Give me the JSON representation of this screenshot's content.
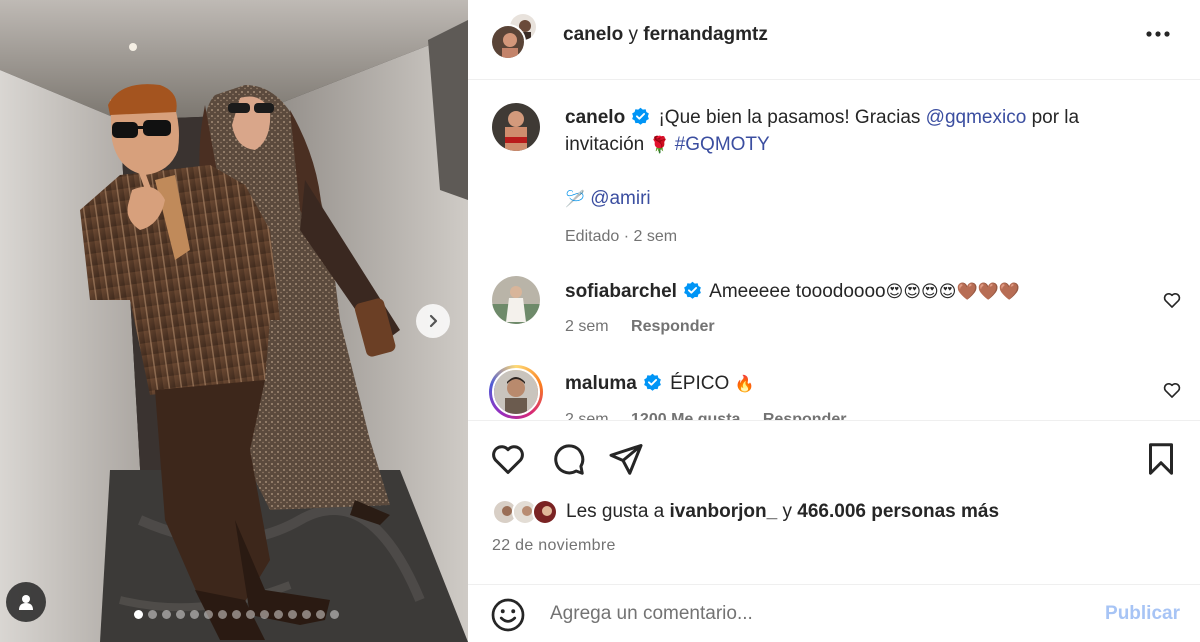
{
  "header": {
    "user1": "canelo",
    "connector": "y",
    "user2": "fernandagmtz"
  },
  "caption": {
    "username": "canelo",
    "text": "¡Que bien la pasamos! Gracias",
    "mention": "@gqmexico",
    "text2": "por la invitación",
    "emoji": "🌹",
    "hashtag": "#GQMOTY",
    "tag_icon": "🪡",
    "tag_mention": "@amiri",
    "edited": "Editado",
    "time": "2 sem"
  },
  "comments": [
    {
      "username": "sofiabarchel",
      "text": "Ameeeee tooodoooo",
      "emojis": "😍😍😍😍🤎🤎🤎",
      "time": "2 sem",
      "reply_label": "Responder"
    },
    {
      "username": "maluma",
      "text": "ÉPICO",
      "emojis": "🔥",
      "time": "2 sem",
      "likes_count": "1200 Me gusta",
      "reply_label": "Responder"
    }
  ],
  "likes": {
    "prefix": "Les gusta a",
    "user": "ivanborjon_",
    "connector": "y",
    "count": "466.006 personas más"
  },
  "date": "22 de noviembre",
  "composer": {
    "placeholder": "Agrega un comentario...",
    "publish": "Publicar"
  },
  "carousel": {
    "total": 15,
    "active": 1
  },
  "colors": {
    "accent_link": "#3b4ea0",
    "publish_disabled": "#a7c4f5",
    "verified": "#0095f6"
  }
}
